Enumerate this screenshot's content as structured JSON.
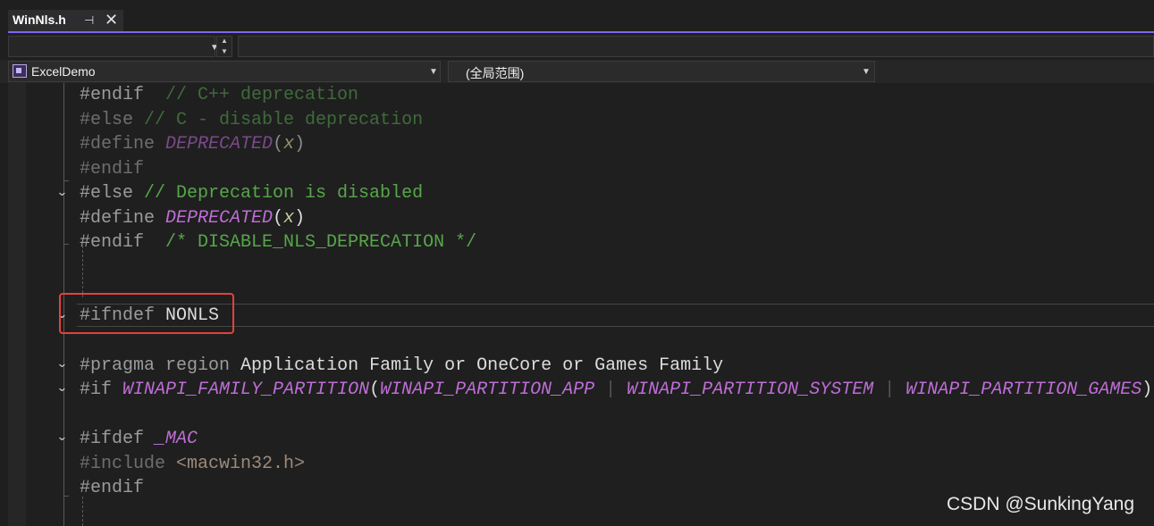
{
  "tab": {
    "title": "WinNls.h",
    "pin_glyph": "⊣",
    "close_glyph": "✕"
  },
  "navbar": {
    "project": "ExcelDemo",
    "scope": "(全局范围)"
  },
  "code": {
    "line1": {
      "kw": "#endif",
      "comment": "  // C++ deprecation"
    },
    "line2": {
      "kw": "#else",
      "comment": " // C - disable deprecation"
    },
    "line3": {
      "kw": "#define",
      "macro": "DEPRECATED",
      "open": "(",
      "param": "x",
      "close": ")"
    },
    "line4": {
      "kw": "#endif"
    },
    "line5": {
      "kw": "#else",
      "comment": " // Deprecation is disabled"
    },
    "line6": {
      "kw": "#define",
      "macro": "DEPRECATED",
      "open": "(",
      "param": "x",
      "close": ")"
    },
    "line7": {
      "kw": "#endif",
      "comment": "  /* DISABLE_NLS_DEPRECATION */"
    },
    "line8": {
      "kw": "#ifndef",
      "name": "NONLS"
    },
    "line9": {
      "kw": "#pragma region",
      "text": "Application Family or OneCore or Games Family"
    },
    "line10": {
      "kw": "#if",
      "macro": "WINAPI_FAMILY_PARTITION",
      "open": "(",
      "a1": "WINAPI_PARTITION_APP",
      "sep1": " | ",
      "a2": "WINAPI_PARTITION_SYSTEM",
      "sep2": " | ",
      "a3": "WINAPI_PARTITION_GAMES",
      "close": ")"
    },
    "line11": {
      "kw": "#ifdef",
      "macro": "_MAC"
    },
    "line12": {
      "kw": "#include",
      "header": "<macwin32.h>"
    },
    "line13": {
      "kw": "#endif"
    }
  },
  "watermark": "CSDN @SunkingYang",
  "colors": {
    "accent": "#7b68ee",
    "highlight_box": "#e5413b",
    "comment": "#57a64a",
    "macro": "#be6dd6"
  }
}
